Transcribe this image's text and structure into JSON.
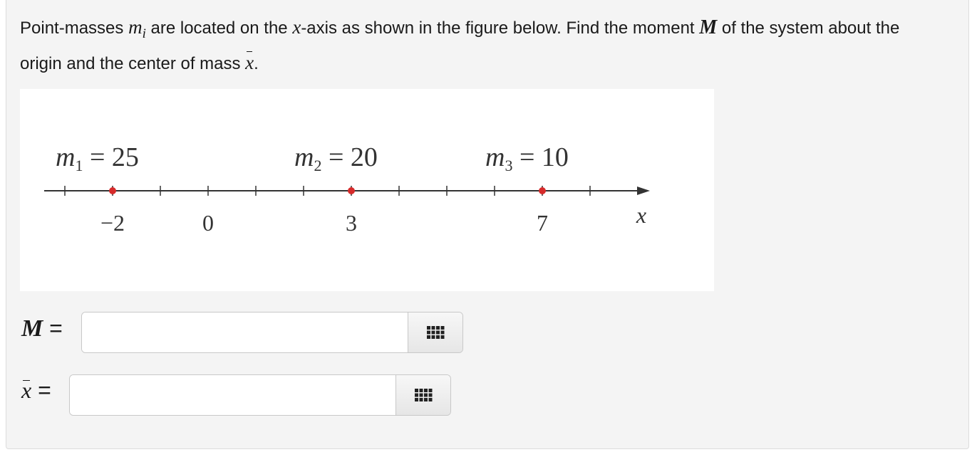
{
  "question": {
    "part1": "Point-masses ",
    "m_symbol": "m",
    "i_sub": "i",
    "part2": " are located on the ",
    "x_symbol": "x",
    "part3": "-axis as shown in the figure below. Find the moment ",
    "M_symbol": "M",
    "part4": " of the system about the origin and the center of mass ",
    "xbar_symbol": "x",
    "part5": "."
  },
  "figure": {
    "masses": [
      {
        "name": "m",
        "sub": "1",
        "eq": " = 25",
        "position": -2,
        "position_label": "−2"
      },
      {
        "name": "m",
        "sub": "2",
        "eq": " = 20",
        "position": 3,
        "position_label": "3"
      },
      {
        "name": "m",
        "sub": "3",
        "eq": " = 10",
        "position": 7,
        "position_label": "7"
      }
    ],
    "origin_label": "0",
    "axis_label": "x",
    "ticks": [
      -3,
      -1,
      0,
      1,
      2,
      4,
      5,
      6,
      8
    ],
    "point_color": "#d62b2b",
    "axis_color": "#333333"
  },
  "answers": {
    "moment": {
      "symbol": "M",
      "eq": " =",
      "value": "",
      "placeholder": ""
    },
    "center": {
      "symbol": "x",
      "eq": " =",
      "value": "",
      "placeholder": ""
    }
  },
  "icons": {
    "keypad": "keypad-grid-icon"
  }
}
